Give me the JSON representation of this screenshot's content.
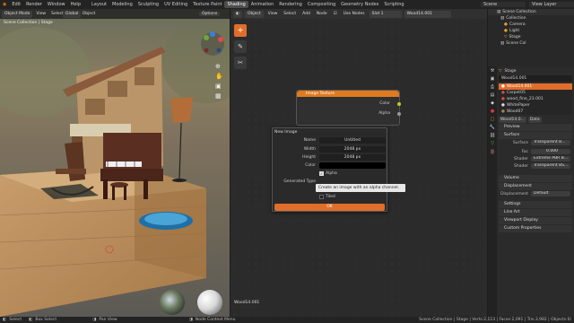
{
  "topbar": {
    "menus": [
      "Edit",
      "Render",
      "Window",
      "Help"
    ],
    "workspaces": [
      "Layout",
      "Modeling",
      "Sculpting",
      "UV Editing",
      "Texture Paint",
      "Shading",
      "Animation",
      "Rendering",
      "Compositing",
      "Geometry Nodes",
      "Scripting"
    ],
    "active_workspace": "Shading",
    "scene": "Scene",
    "view_layer": "View Layer"
  },
  "viewport": {
    "mode": "Object Mode",
    "menus": [
      "View",
      "Select",
      "Add",
      "Object"
    ],
    "orientation": "Global",
    "options": "Options",
    "collection_label": "Scene Collection | Stage"
  },
  "node_editor": {
    "type_label": "Object",
    "menus": [
      "View",
      "Select",
      "Add",
      "Node"
    ],
    "use_nodes_label": "Use Nodes",
    "slot": "Slot 1",
    "material": "Wood14.001",
    "footer_material": "Wood14.001",
    "node": {
      "title": "Image Texture",
      "outputs": [
        "Color",
        "Alpha"
      ]
    },
    "popup": {
      "title": "New Image",
      "name_label": "Name",
      "name_value": "Untitled",
      "width_label": "Width",
      "width_value": "2048 px",
      "height_label": "Height",
      "height_value": "2048 px",
      "color_label": "Color",
      "alpha_label": "Alpha",
      "generated_type_label": "Generated Type",
      "tiled_label": "Tiled",
      "ok_label": "OK"
    },
    "tooltip": "Create an image with an alpha channel."
  },
  "outliner": {
    "root": "Scene Collection",
    "items": [
      "Collection",
      "Camera",
      "Light",
      "Stage",
      "Scene Col"
    ]
  },
  "properties": {
    "object_name": "Stage",
    "material_name": "Wood14.001",
    "materials": [
      "Wood14.001",
      "Carpet05",
      "wood_fine_23.001",
      "WhitePaper",
      "Wood07"
    ],
    "slot_name": "Wood14.0...",
    "data_label": "Data",
    "sections": {
      "preview": "Preview",
      "surface": "Surface",
      "volume": "Volume",
      "displacement": "Displacement",
      "settings": "Settings",
      "line_art": "Line Art",
      "viewport_display": "Viewport Display",
      "custom_properties": "Custom Properties"
    },
    "surface_label": "Surface",
    "surface_value": "Transparent B...",
    "fac_label": "Fac",
    "fac_value": "0.000",
    "shader1_label": "Shader",
    "shader1_value": "Extreme PBR B...",
    "shader2_label": "Shader",
    "shader2_value": "Transparent BS...",
    "displacement_label": "Displacement",
    "displacement_value": "Default"
  },
  "statusbar": {
    "select": "Select",
    "box_select": "Box Select",
    "pan_view": "Pan View",
    "node_context": "Node Context Menu",
    "stats": "Scene Collection | Stage | Verts:2,113 | Faces:2,091 | Tris:3,982 | Objects:0/"
  }
}
